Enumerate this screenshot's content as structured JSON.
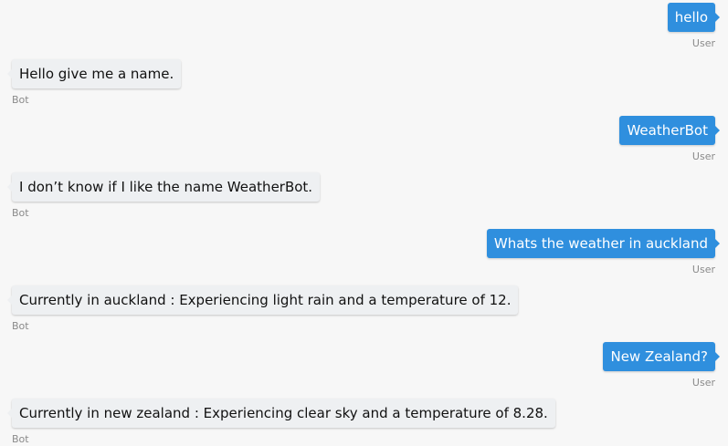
{
  "messages": [
    {
      "sender": "User",
      "text": "hello"
    },
    {
      "sender": "Bot",
      "text": "Hello give me a name."
    },
    {
      "sender": "User",
      "text": "WeatherBot"
    },
    {
      "sender": "Bot",
      "text": "I don’t know if I like the name WeatherBot."
    },
    {
      "sender": "User",
      "text": "Whats the weather in auckland"
    },
    {
      "sender": "Bot",
      "text": "Currently in auckland : Experiencing light rain and a temperature of 12."
    },
    {
      "sender": "User",
      "text": "New Zealand?"
    },
    {
      "sender": "Bot",
      "text": "Currently in new zealand : Experiencing clear sky and a temperature of 8.28."
    }
  ],
  "colors": {
    "user_bubble": "#2f8fde",
    "bot_bubble": "#eef0f2",
    "background": "#f7f7f7"
  }
}
